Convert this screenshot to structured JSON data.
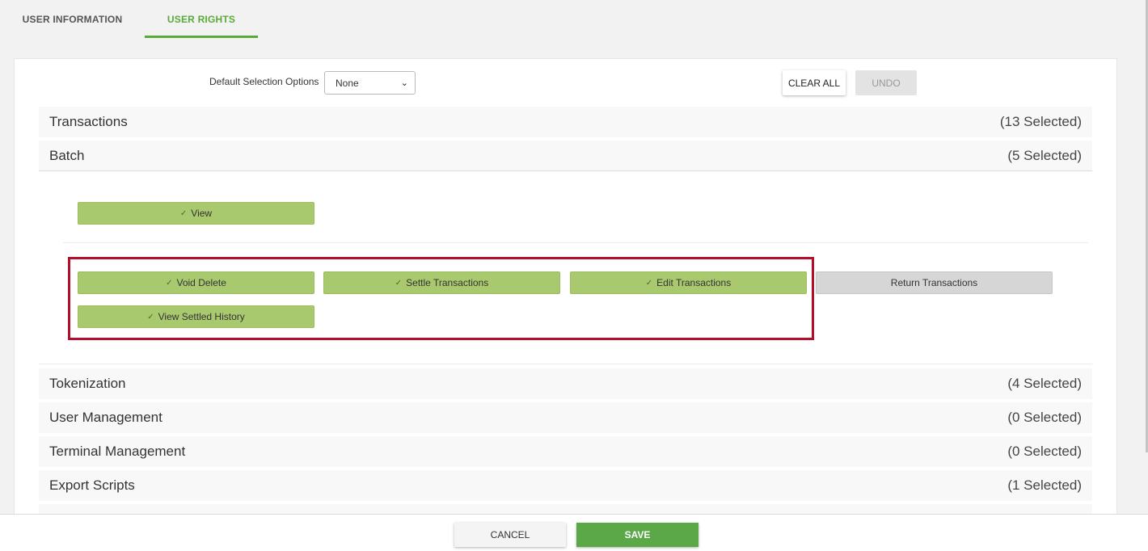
{
  "tabs": [
    {
      "label": "USER INFORMATION"
    },
    {
      "label": "USER RIGHTS"
    }
  ],
  "toolbar": {
    "default_selection_label": "Default Selection Options",
    "default_selection_value": "None",
    "clear_all_label": "CLEAR ALL",
    "undo_label": "UNDO"
  },
  "sections": [
    {
      "name": "Transactions",
      "count": "(13 Selected)"
    },
    {
      "name": "Batch",
      "count": "(5 Selected)"
    },
    {
      "name": "Tokenization",
      "count": "(4 Selected)"
    },
    {
      "name": "User Management",
      "count": "(0 Selected)"
    },
    {
      "name": "Terminal Management",
      "count": "(0 Selected)"
    },
    {
      "name": "Export Scripts",
      "count": "(1 Selected)"
    }
  ],
  "batch_permissions": {
    "view": {
      "label": "View",
      "selected": true
    },
    "void_delete": {
      "label": "Void Delete",
      "selected": true
    },
    "settle_transactions": {
      "label": "Settle Transactions",
      "selected": true
    },
    "edit_transactions": {
      "label": "Edit Transactions",
      "selected": true
    },
    "return_transactions": {
      "label": "Return Transactions",
      "selected": false
    },
    "view_settled_history": {
      "label": "View Settled History",
      "selected": true
    }
  },
  "check_glyph": "✓",
  "footer": {
    "cancel_label": "CANCEL",
    "save_label": "SAVE"
  },
  "colors": {
    "accent_green": "#5aa847",
    "selected_permission": "#a9c96e",
    "unselected_permission": "#d6d6d6",
    "highlight_border": "#b50e2b"
  }
}
